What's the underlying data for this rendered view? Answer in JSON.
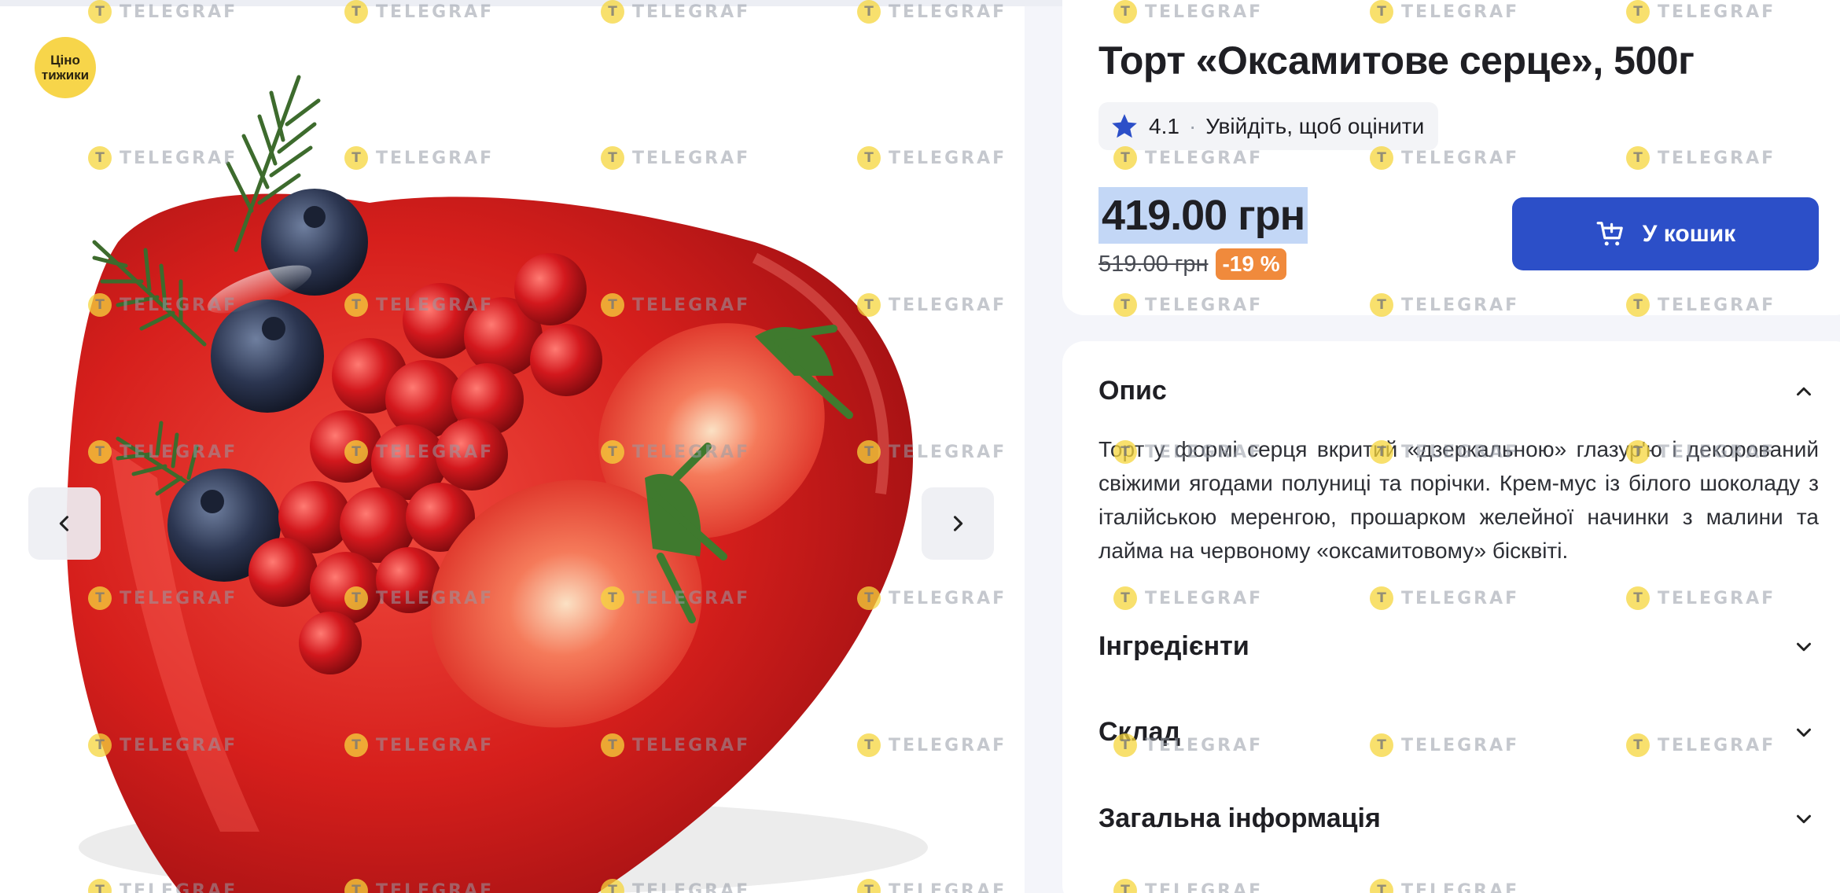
{
  "gallery": {
    "badge_text": "Ціно тижики",
    "prev_icon": "chevron-left-icon",
    "next_icon": "chevron-right-icon"
  },
  "product": {
    "title": "Торт «Оксамитове серце», 500г",
    "rating_value": "4.1",
    "rating_separator": "·",
    "rating_login_text": "Увійдіть, щоб оцінити",
    "price_current": "419.00 грн",
    "price_old": "519.00 грн",
    "discount": "-19 %",
    "cart_button": "У кошик"
  },
  "accordion": {
    "description_title": "Опис",
    "description_text": "Торт у формі серця вкритий «дзеркальною» глазур'ю і декорований свіжими ягодами полуниці та порічки. Крем-мус із білого шоколаду з італійською меренгою, прошарком желейної начинки з малини та лайма на червоному «оксамитовому» бісквіті.",
    "ingredients_title": "Інгредієнти",
    "composition_title": "Склад",
    "general_info_title": "Загальна інформація"
  },
  "watermark": {
    "text": "TELEGRAF",
    "logo_letter": "T"
  },
  "colors": {
    "brand_blue": "#2c4fc8",
    "discount_orange": "#f08a3c",
    "price_highlight": "#c3d7f6",
    "badge_yellow": "#f7d54a",
    "page_background": "#f4f5fa"
  }
}
